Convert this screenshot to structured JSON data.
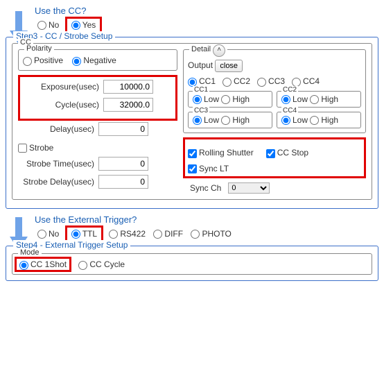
{
  "sec1": {
    "question": "Use the CC?",
    "no": "No",
    "yes": "Yes"
  },
  "step3": {
    "legend": "Step3 - CC / Strobe Setup",
    "cc": "CC",
    "polarity": "Polarity",
    "positive": "Positive",
    "negative": "Negative",
    "exposure_lbl": "Exposure(usec)",
    "exposure_val": "10000.0",
    "cycle_lbl": "Cycle(usec)",
    "cycle_val": "32000.0",
    "delay_lbl": "Delay(usec)",
    "delay_val": "0",
    "strobe": "Strobe",
    "strobe_time_lbl": "Strobe Time(usec)",
    "strobe_time_val": "0",
    "strobe_delay_lbl": "Strobe Delay(usec)",
    "strobe_delay_val": "0",
    "detail": "Detail",
    "output": "Output",
    "close": "close",
    "cc1": "CC1",
    "cc2": "CC2",
    "cc3": "CC3",
    "cc4": "CC4",
    "low": "Low",
    "high": "High",
    "rolling": "Rolling Shutter",
    "ccstop": "CC Stop",
    "synclt": "Sync LT",
    "syncch": "Sync Ch",
    "syncch_val": "0"
  },
  "sec2": {
    "question": "Use the External Trigger?",
    "no": "No",
    "ttl": "TTL",
    "rs422": "RS422",
    "diff": "DIFF",
    "photo": "PHOTO"
  },
  "step4": {
    "legend": "Step4 - External Trigger Setup",
    "mode": "Mode",
    "cc1shot": "CC 1Shot",
    "cccycle": "CC Cycle"
  }
}
